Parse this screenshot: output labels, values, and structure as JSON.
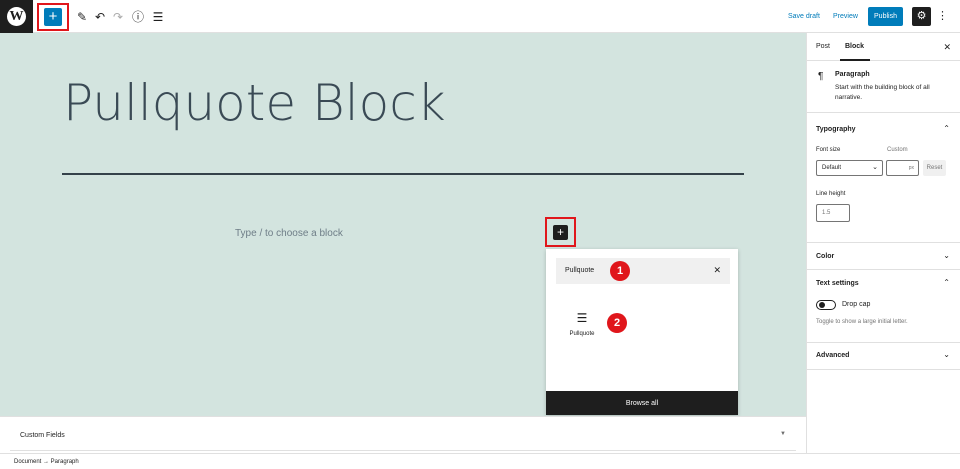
{
  "topbar": {
    "logo": "W",
    "add_icon": "plus-icon",
    "save_draft": "Save draft",
    "preview": "Preview",
    "publish": "Publish"
  },
  "editor": {
    "title": "Pullquote Block",
    "placeholder": "Type / to choose a block"
  },
  "inserter": {
    "search_value": "Pullquote",
    "results": [
      {
        "label": "Pullquote",
        "icon": "pullquote-icon"
      }
    ],
    "browse_all": "Browse all",
    "badges": [
      "1",
      "2"
    ]
  },
  "custom_fields": {
    "label": "Custom Fields"
  },
  "breadcrumb": {
    "text": "Document → Paragraph"
  },
  "sidebar": {
    "tabs": [
      "Post",
      "Block"
    ],
    "active_tab": "Block",
    "block_title": "Paragraph",
    "block_desc": "Start with the building block of all narrative.",
    "typography": {
      "title": "Typography",
      "font_size_label": "Font size",
      "custom_label": "Custom",
      "font_size_value": "Default",
      "custom_unit": "px",
      "reset": "Reset",
      "line_height_label": "Line height",
      "line_height_placeholder": "1.5"
    },
    "color": {
      "title": "Color"
    },
    "text_settings": {
      "title": "Text settings",
      "drop_cap": "Drop cap",
      "help": "Toggle to show a large initial letter."
    },
    "advanced": {
      "title": "Advanced"
    }
  },
  "colors": {
    "accent": "#007cba",
    "canvas": "#d3e4df",
    "highlight": "#e0161b"
  }
}
